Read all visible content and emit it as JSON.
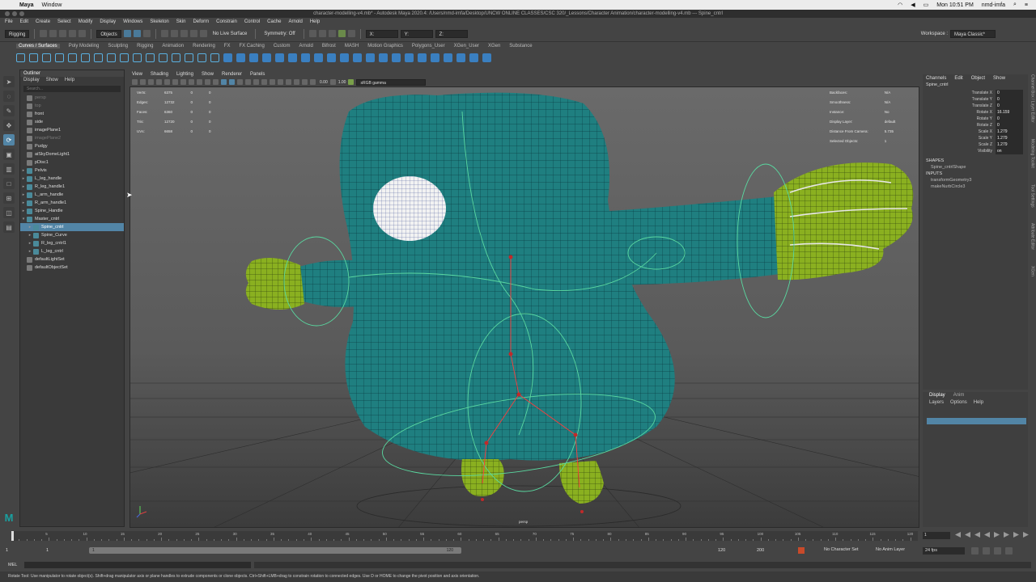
{
  "mac_menubar": {
    "app": "Maya",
    "window": "Window",
    "clock": "Mon 10:51 PM",
    "user": "nmd-imfa"
  },
  "title": "character-modelling-v4.mb* - Autodesk Maya 2020.4: /Users/nmd-imfa/Desktop/UNCW ONLINE CLASSES/CSC 320/_Lessons/Character Animation/character-modelling-v4.mb  ---  Spine_cntrl",
  "menu": [
    "File",
    "Edit",
    "Create",
    "Select",
    "Modify",
    "Display",
    "Windows",
    "Skeleton",
    "Skin",
    "Deform",
    "Constrain",
    "Control",
    "Cache",
    "Arnold",
    "Help"
  ],
  "status": {
    "menuset": "Rigging",
    "objects": "Objects",
    "live_surface": "No Live Surface",
    "symmetry": "Symmetry: Off",
    "workspace_label": "Workspace :",
    "workspace": "Maya Classic*"
  },
  "shelf_tabs": [
    "Curves / Surfaces",
    "Poly Modeling",
    "Sculpting",
    "Rigging",
    "Animation",
    "Rendering",
    "FX",
    "FX Caching",
    "Custom",
    "Arnold",
    "Bifrost",
    "MASH",
    "Motion Graphics",
    "Polygons_User",
    "XGen_User",
    "XGen",
    "Substance"
  ],
  "outliner": {
    "title": "Outliner",
    "menu": [
      "Display",
      "Show",
      "Help"
    ],
    "search": "Search...",
    "items": [
      {
        "label": "persp",
        "dim": true,
        "expand": ""
      },
      {
        "label": "top",
        "dim": true,
        "expand": ""
      },
      {
        "label": "front",
        "dim": false,
        "expand": ""
      },
      {
        "label": "side",
        "dim": false,
        "expand": ""
      },
      {
        "label": "imagePlane1",
        "dim": false,
        "expand": ""
      },
      {
        "label": "imagePlane2",
        "dim": true,
        "expand": ""
      },
      {
        "label": "Pudgy",
        "dim": false,
        "expand": ""
      },
      {
        "label": "aiSkyDomeLight1",
        "dim": false,
        "expand": ""
      },
      {
        "label": "pDisc1",
        "dim": false,
        "expand": ""
      },
      {
        "label": "Pelvis",
        "dim": false,
        "expand": "+"
      },
      {
        "label": "L_leg_handle",
        "dim": false,
        "expand": "+"
      },
      {
        "label": "R_leg_handle1",
        "dim": false,
        "expand": "+"
      },
      {
        "label": "L_arm_handle",
        "dim": false,
        "expand": "+"
      },
      {
        "label": "R_arm_handle1",
        "dim": false,
        "expand": "+"
      },
      {
        "label": "Spine_Handle",
        "dim": false,
        "expand": "+"
      },
      {
        "label": "Master_cntrl",
        "dim": false,
        "expand": "-"
      },
      {
        "label": "Spine_cntrl",
        "dim": false,
        "expand": "+",
        "selected": true,
        "indent": true
      },
      {
        "label": "Spine_Curve",
        "dim": false,
        "expand": "+",
        "indent": true
      },
      {
        "label": "R_leg_cntrl1",
        "dim": false,
        "expand": "+",
        "indent": true
      },
      {
        "label": "L_leg_cntrl",
        "dim": false,
        "expand": "+",
        "indent": true
      },
      {
        "label": "defaultLightSet",
        "dim": false,
        "expand": ""
      },
      {
        "label": "defaultObjectSet",
        "dim": false,
        "expand": ""
      }
    ]
  },
  "viewport": {
    "menu": [
      "View",
      "Shading",
      "Lighting",
      "Show",
      "Renderer",
      "Panels"
    ],
    "near": "0.00",
    "far": "1.00",
    "colorspace": "sRGB gamma",
    "camera": "persp",
    "hud_left": [
      [
        "Verts:",
        "6375",
        "0",
        "0"
      ],
      [
        "Edges:",
        "12732",
        "0",
        "0"
      ],
      [
        "Faces:",
        "6360",
        "0",
        "0"
      ],
      [
        "Tris:",
        "12720",
        "0",
        "0"
      ],
      [
        "UVs:",
        "6658",
        "0",
        "0"
      ]
    ],
    "hud_right": [
      [
        "Backfaces:",
        "N/A"
      ],
      [
        "Smoothness:",
        "N/A"
      ],
      [
        "Instance:",
        "No"
      ],
      [
        "Display Layer:",
        "default"
      ],
      [
        "Distance From Camera:",
        "5.735"
      ],
      [
        "Selected Objects:",
        "1"
      ]
    ]
  },
  "channel_box": {
    "menu": [
      "Channels",
      "Edit",
      "Object",
      "Show"
    ],
    "object": "Spine_cntrl",
    "attrs": [
      [
        "Translate X",
        "0"
      ],
      [
        "Translate Y",
        "0"
      ],
      [
        "Translate Z",
        "0"
      ],
      [
        "Rotate X",
        "16.159"
      ],
      [
        "Rotate Y",
        "0"
      ],
      [
        "Rotate Z",
        "0"
      ],
      [
        "Scale X",
        "1.279"
      ],
      [
        "Scale Y",
        "1.279"
      ],
      [
        "Scale Z",
        "1.279"
      ],
      [
        "Visibility",
        "on"
      ]
    ],
    "shapes_label": "SHAPES",
    "shape": "Spine_cntrlShape",
    "inputs_label": "INPUTS",
    "inputs": [
      "transformGeometry3",
      "makeNurbCircle3"
    ]
  },
  "side_tabs": [
    "Channel Box / Layer Editor",
    "Modeling Toolkit",
    "Tool Settings",
    "Attribute Editor",
    "XGen"
  ],
  "layer_editor": {
    "tabs": [
      "Display",
      "Anim"
    ],
    "menu": [
      "Layers",
      "Options",
      "Help"
    ]
  },
  "timeline": {
    "ticks": [
      "5",
      "10",
      "15",
      "20",
      "25",
      "30",
      "35",
      "40",
      "45",
      "50",
      "55",
      "60",
      "65",
      "70",
      "75",
      "80",
      "85",
      "90",
      "95",
      "100",
      "105",
      "110",
      "115",
      "120"
    ],
    "current": "1"
  },
  "range": {
    "start": "1",
    "start_inner": "1",
    "slider_start": "1",
    "slider_end": "120",
    "end_inner": "120",
    "end": "200",
    "char_set": "No Character Set",
    "anim_layer": "No Anim Layer",
    "fps": "24 fps"
  },
  "command": {
    "lang": "MEL"
  },
  "help_line": "Rotate Tool: Use manipulator to rotate object(s). Shift+drag manipulator axis or plane handles to extrude components or clone objects. Ctrl+Shift+LMB+drag to constrain rotation to connected edges. Use D or HOME to change the pivot position and axis orientation.",
  "colors": {
    "accent": "#5285a6",
    "mesh": "#1f7f80",
    "hands": "#8ab020"
  }
}
